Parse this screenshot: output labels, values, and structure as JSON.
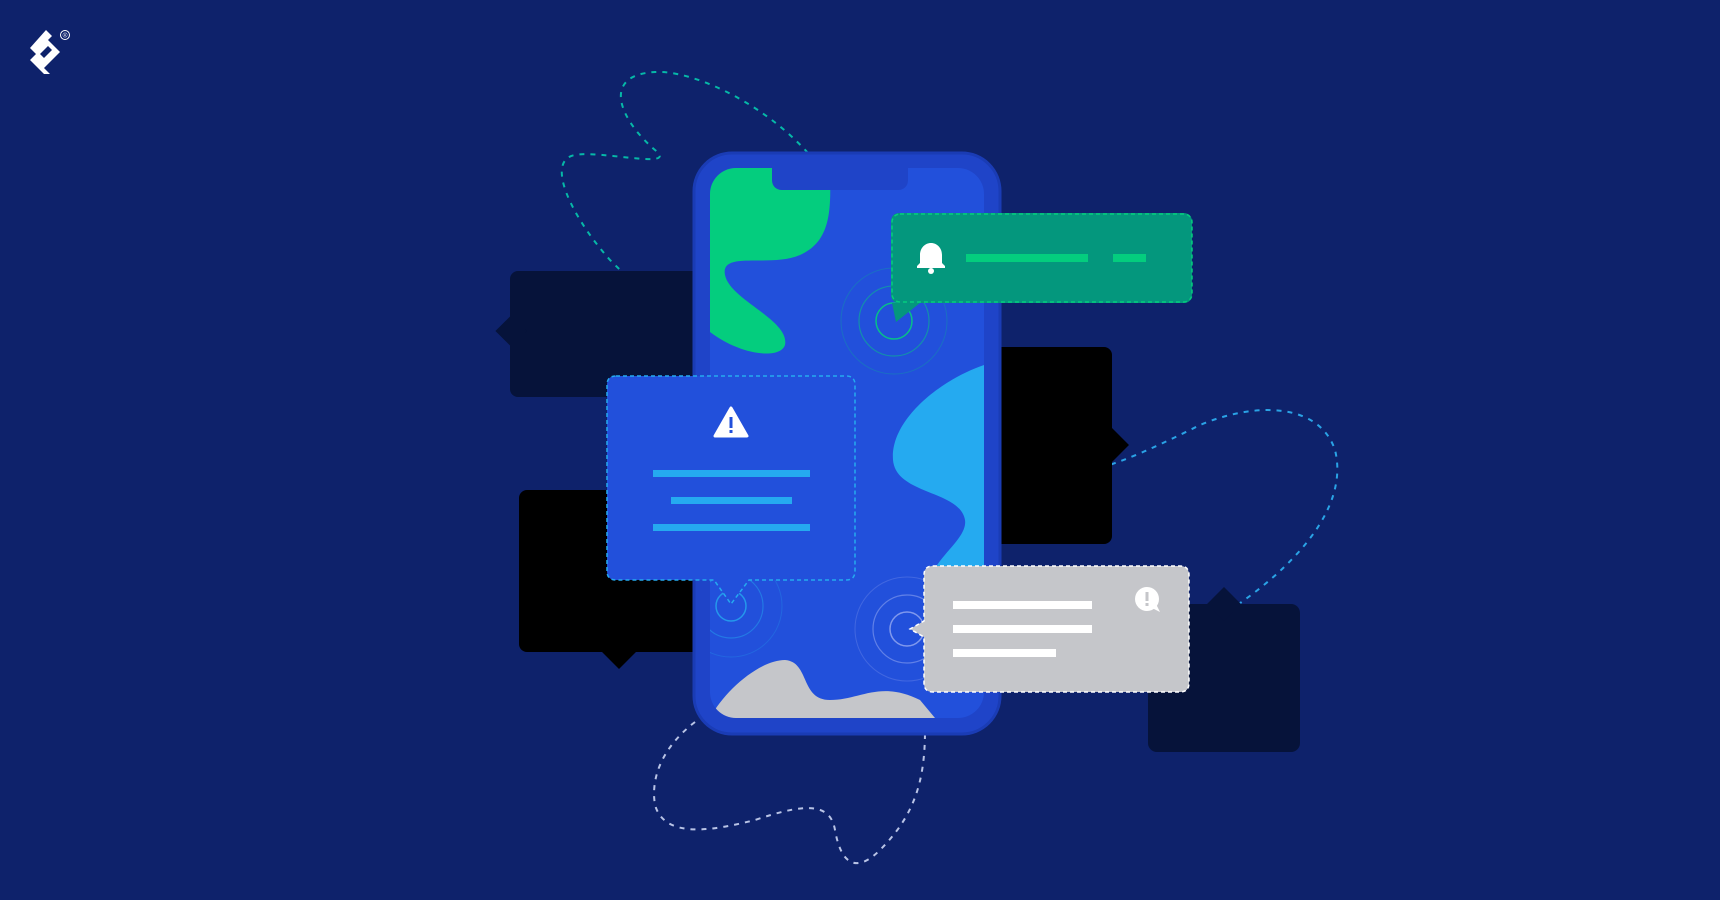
{
  "brand": {
    "logo_icon": "toptal-logo-icon",
    "registered_mark": "®"
  },
  "colors": {
    "background": "#0e226b",
    "phone_frame": "#1f44c8",
    "phone_screen": "#2250db",
    "accent_green": "#04cd7e",
    "accent_teal": "#04977d",
    "accent_light_blue": "#25aaf0",
    "card_gray": "#c5c6ca",
    "shadow_dark": "#06133a",
    "shadow_black": "#000000"
  },
  "notifications": [
    {
      "kind": "alert",
      "icon": "bell-icon",
      "color": "#04977d"
    },
    {
      "kind": "warning",
      "icon": "warning-icon",
      "color": "#2250db"
    },
    {
      "kind": "info",
      "icon": "exclamation-bubble-icon",
      "color": "#c5c6ca"
    }
  ]
}
